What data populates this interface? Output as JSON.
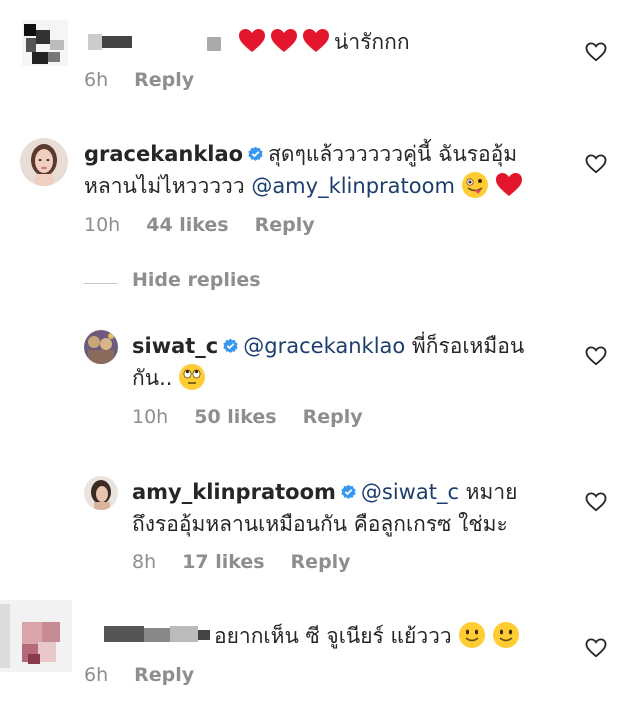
{
  "comments": [
    {
      "username": "",
      "text": "น่ารักกก",
      "time": "6h",
      "likes": "",
      "reply": "Reply"
    },
    {
      "username": "gracekanklao",
      "text": "สุดๆแล้ววววววคู่นี้ ฉันรออุ้ม",
      "text2": "หลานไม่ไหววววว ",
      "mention": "@amy_klinpratoom",
      "time": "10h",
      "likes": "44 likes",
      "reply": "Reply"
    },
    {
      "hide_replies": "Hide replies"
    },
    {
      "username": "siwat_c",
      "mention": "@gracekanklao",
      "text": " พี่ก็รอเหมือน",
      "text2": "กัน..",
      "time": "10h",
      "likes": "50 likes",
      "reply": "Reply"
    },
    {
      "username": "amy_klinpratoom",
      "mention": "@siwat_c",
      "text": " หมาย",
      "text2": "ถึงรออุ้มหลานเหมือนกัน คือลูกเกรซ ใช่มะ",
      "time": "8h",
      "likes": "17 likes",
      "reply": "Reply"
    },
    {
      "username": "",
      "text": "อยากเห็น ซี จูเนียร์ แย้ววว",
      "time": "6h",
      "likes": "",
      "reply": "Reply"
    }
  ],
  "colors": {
    "accent_red": "#e2162c",
    "mention_blue": "#1c3e6e",
    "verified_blue": "#3897f0",
    "meta_gray": "#8e8e8e"
  },
  "icons": {
    "like": "heart-outline-icon",
    "verified": "verified-badge-icon",
    "heart_emoji": "red-heart-emoji",
    "tongue_emoji": "zany-face-emoji",
    "eyeroll_emoji": "eye-roll-emoji",
    "smile_emoji": "slightly-smiling-face-emoji"
  }
}
